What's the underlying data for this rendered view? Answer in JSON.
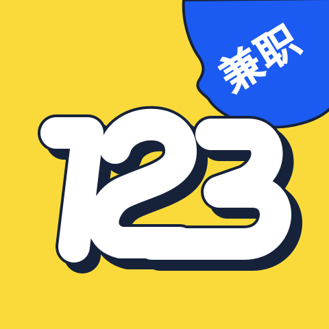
{
  "app_icon": {
    "number_text": "123",
    "badge_text": "兼职"
  },
  "colors": {
    "background": "#F9DA3A",
    "badge": "#1B5BF2",
    "number_fill": "#FFFFFF",
    "outline": "#16223A",
    "badge_text": "#FFFFFF"
  },
  "icons": {
    "speech_bubble": "speech-bubble-icon",
    "numerals": "numerals-123-logo"
  }
}
